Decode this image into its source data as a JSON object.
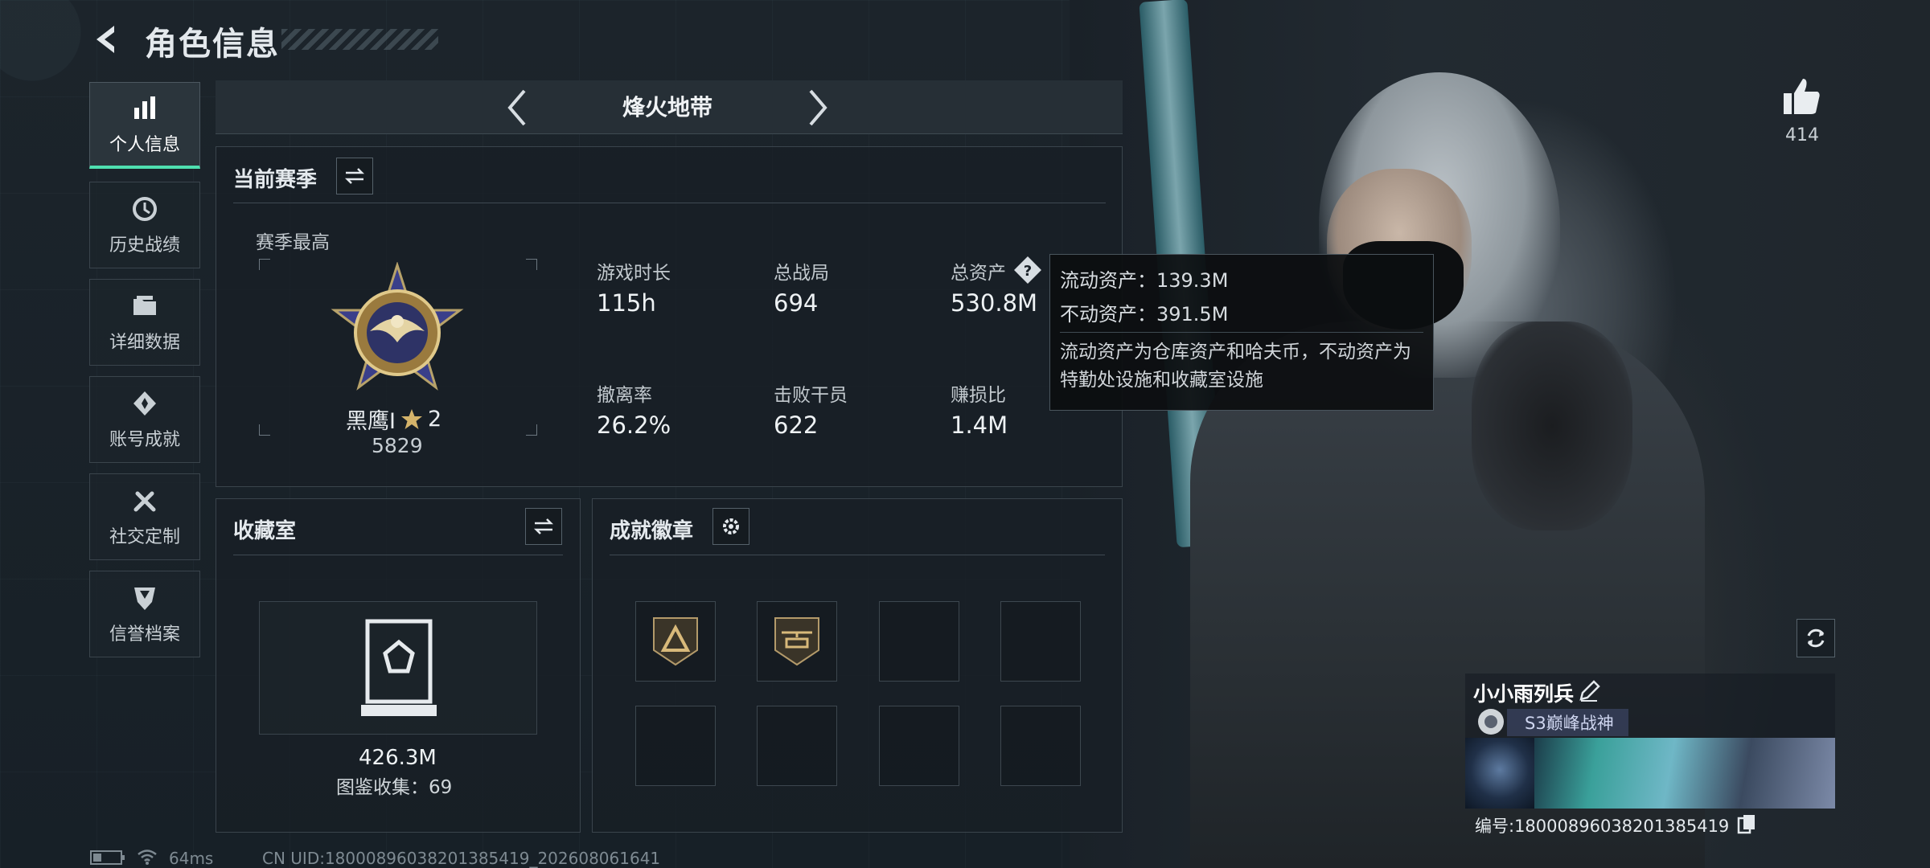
{
  "header": {
    "title": "角色信息"
  },
  "nav": [
    {
      "label": "个人信息",
      "icon": "bar-chart-icon",
      "active": true
    },
    {
      "label": "历史战绩",
      "icon": "clock-history-icon",
      "active": false
    },
    {
      "label": "详细数据",
      "icon": "folder-icon",
      "active": false
    },
    {
      "label": "账号成就",
      "icon": "achievement-icon",
      "active": false
    },
    {
      "label": "社交定制",
      "icon": "tools-icon",
      "active": false
    },
    {
      "label": "信誉档案",
      "icon": "shield-icon",
      "active": false
    }
  ],
  "season_selector": {
    "name": "烽火地带"
  },
  "current_season": {
    "title": "当前赛季",
    "best_label": "赛季最高",
    "rank_name": "黑鹰I",
    "rank_stars": "2",
    "rank_points": "5829",
    "stats": [
      {
        "label": "游戏时长",
        "value": "115h"
      },
      {
        "label": "总战局",
        "value": "694"
      },
      {
        "label": "总资产",
        "value": "530.8M"
      },
      {
        "label": "撤离率",
        "value": "26.2%"
      },
      {
        "label": "击败干员",
        "value": "622"
      },
      {
        "label": "赚损比",
        "value": "1.4M"
      }
    ]
  },
  "tooltip": {
    "liquid": "流动资产：139.3M",
    "fixed": "不动资产：391.5M",
    "desc": "流动资产为仓库资产和哈夫币，不动资产为特勤处设施和收藏室设施"
  },
  "collection": {
    "title": "收藏室",
    "value": "426.3M",
    "catalog": "图鉴收集：69"
  },
  "badges": {
    "title": "成就徽章"
  },
  "likes": {
    "count": "414"
  },
  "profile": {
    "name": "小小雨列兵",
    "title": "S3巅峰战神",
    "id_label": "编号:18000896038201385419"
  },
  "status_bar": {
    "ping": "64ms",
    "uid": "CN UID:18000896038201385419_202608061641"
  },
  "colors": {
    "accent": "#4fe0b0",
    "panel_border": "#3a444c"
  }
}
